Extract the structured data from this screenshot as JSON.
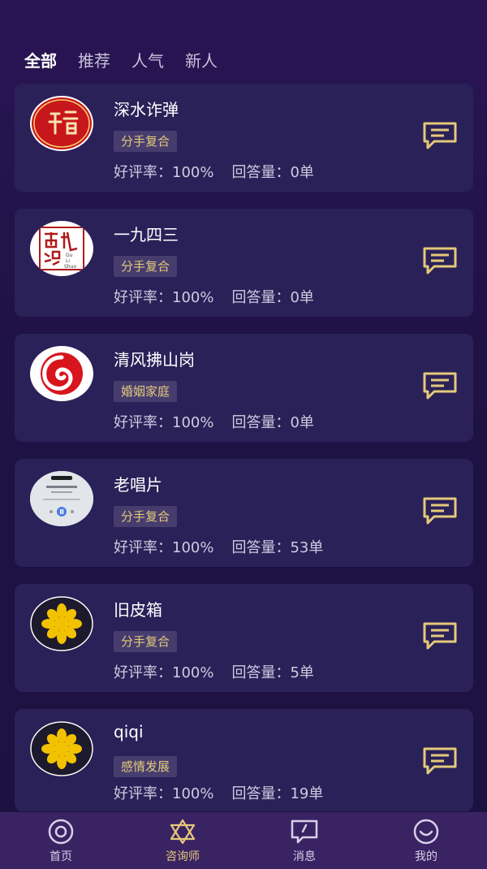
{
  "tabs": [
    "全部",
    "推荐",
    "人气",
    "新人"
  ],
  "stat_labels": {
    "rating": "好评率：",
    "answers": "回答量："
  },
  "consultants": [
    {
      "name": "深水诈弹",
      "tag": "分手复合",
      "rating": "100%",
      "answers": "0单",
      "avatar": "fu-seal-icon"
    },
    {
      "name": "一九四三",
      "tag": "分手复合",
      "rating": "100%",
      "answers": "0单",
      "avatar": "guli-shuo-seal-icon"
    },
    {
      "name": "清风拂山岗",
      "tag": "婚姻家庭",
      "rating": "100%",
      "answers": "0单",
      "avatar": "red-swirl-icon"
    },
    {
      "name": "老唱片",
      "tag": "分手复合",
      "rating": "100%",
      "answers": "53单",
      "avatar": "music-player-icon"
    },
    {
      "name": "旧皮箱",
      "tag": "分手复合",
      "rating": "100%",
      "answers": "5单",
      "avatar": "yellow-flower-icon"
    },
    {
      "name": "qiqi",
      "tag": "感情发展",
      "rating": "100%",
      "answers": "19单",
      "avatar": "yellow-flower-icon"
    }
  ],
  "nav": [
    {
      "label": "首页",
      "icon": "target-icon"
    },
    {
      "label": "咨询师",
      "icon": "star-of-david-icon"
    },
    {
      "label": "消息",
      "icon": "message-icon"
    },
    {
      "label": "我的",
      "icon": "smile-icon"
    }
  ],
  "colors": {
    "accent": "#e4c97a",
    "card": "#2a2158",
    "nav": "#3a2363"
  }
}
